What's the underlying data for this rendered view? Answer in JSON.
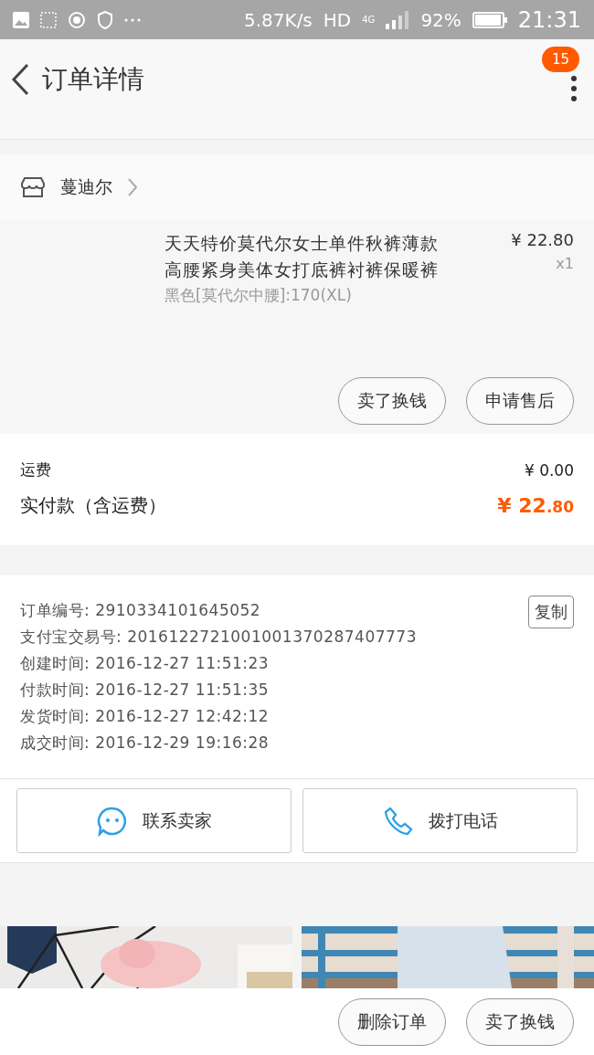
{
  "status_bar": {
    "network_speed": "5.87K/s",
    "hd": "HD",
    "network": "4G",
    "battery": "92%",
    "time": "21:31"
  },
  "header": {
    "title": "订单详情",
    "badge": "15"
  },
  "shop": {
    "name": "蔓迪尔"
  },
  "product": {
    "title": "天天特价莫代尔女士单件秋裤薄款高腰紧身美体女打底裤衬裤保暖裤",
    "spec": "黑色[莫代尔中腰]:170(XL)",
    "price": "¥ 22.80",
    "quantity": "x1",
    "actions": [
      "卖了换钱",
      "申请售后"
    ]
  },
  "summary": {
    "shipping_label": "运费",
    "shipping": "¥ 0.00",
    "total_label": "实付款（含运费）",
    "total": "¥ 22.80"
  },
  "order_info": {
    "rows": [
      "订单编号: 2910334101645052",
      "支付宝交易号: 2016122721001001370287407773",
      "创建时间: 2016-12-27 11:51:23",
      "付款时间: 2016-12-27 11:51:35",
      "发货时间: 2016-12-27 12:42:12",
      "成交时间: 2016-12-29 19:16:28"
    ],
    "copy": "复制"
  },
  "contact": [
    {
      "kind": "chat",
      "label": "联系卖家"
    },
    {
      "kind": "phone",
      "label": "拨打电话"
    }
  ],
  "bottom_actions": [
    "删除订单",
    "卖了换钱"
  ]
}
